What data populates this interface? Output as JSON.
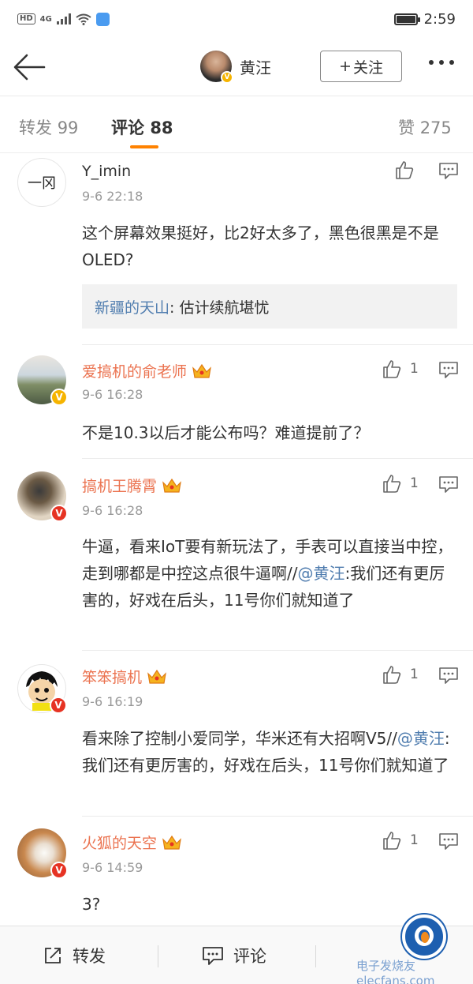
{
  "status_bar": {
    "hd": "HD",
    "network": "4G",
    "time": "2:59"
  },
  "nav": {
    "author_name": "黄汪",
    "follow_label": "关注",
    "verified_badge": "V"
  },
  "tabs": [
    {
      "label": "转发",
      "count": "99"
    },
    {
      "label": "评论",
      "count": "88"
    },
    {
      "label": "赞",
      "count": "275"
    }
  ],
  "comments": [
    {
      "username": "Y_imin",
      "avatar_text": "一冈",
      "time": "9-6 22:18",
      "text": "这个屏幕效果挺好，比2好太多了，黑色很黑是不是OLED?",
      "likes": "",
      "reply": {
        "name": "新疆的天山",
        "text": ": 估计续航堪忧"
      }
    },
    {
      "username": "爱搞机的俞老师",
      "time": "9-6 16:28",
      "text": "不是10.3以后才能公布吗？难道提前了？",
      "likes": "1"
    },
    {
      "username": "搞机王腾霄",
      "time": "9-6 16:28",
      "text_before": "牛逼，看来IoT要有新玩法了，手表可以直接当中控，走到哪都是中控这点很牛逼啊//",
      "mention": "@黄汪",
      "text_after": ":我们还有更厉害的，好戏在后头，11号你们就知道了",
      "likes": "1"
    },
    {
      "username": "笨笨搞机",
      "time": "9-6 16:19",
      "text_before": "看来除了控制小爱同学，华米还有大招啊V5//",
      "mention": "@黄汪",
      "text_after": ":我们还有更厉害的，好戏在后头，11号你们就知道了",
      "likes": "1"
    },
    {
      "username": "火狐的天空",
      "time": "9-6 14:59",
      "text": "3?",
      "likes": "1"
    }
  ],
  "bottom_bar": {
    "forward_label": "转发",
    "comment_label": "评论"
  },
  "watermark": {
    "text": "电子发烧友 elecfans.com"
  },
  "colors": {
    "accent": "#ff8200",
    "username_orange": "#eb7350",
    "mention_blue": "#507daf",
    "verified_yellow": "#f6b400",
    "verified_red": "#e63323"
  }
}
